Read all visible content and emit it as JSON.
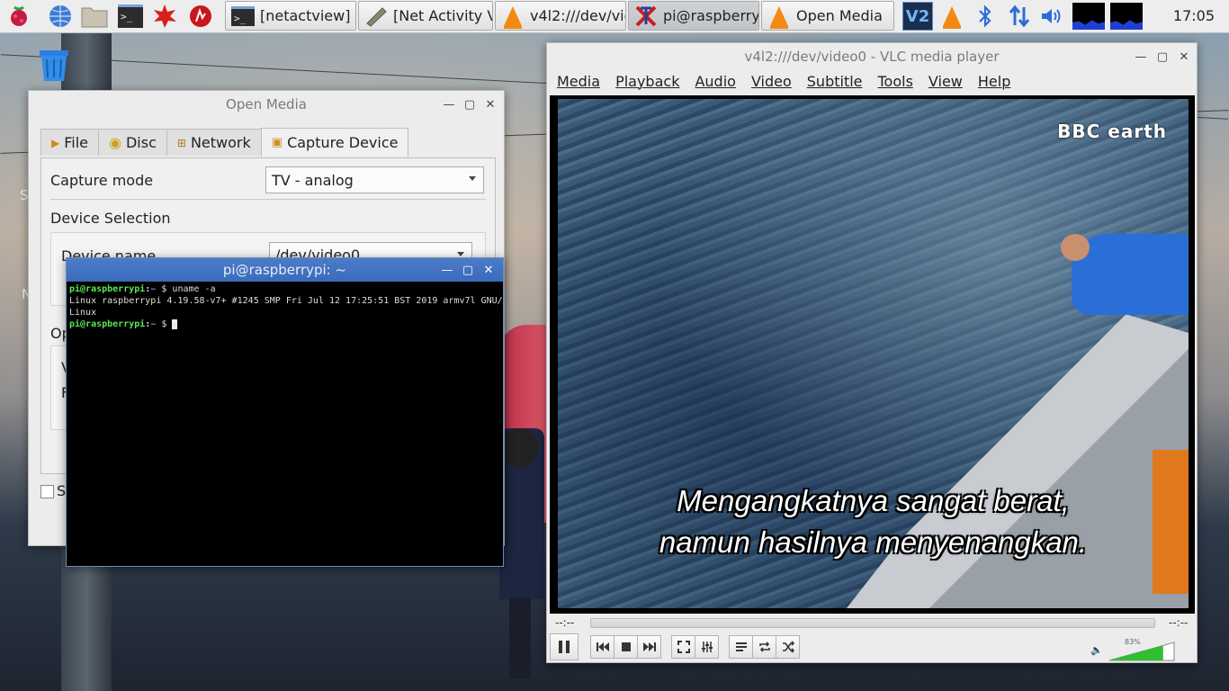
{
  "taskbar": {
    "buttons": [
      {
        "label": "[netactview]"
      },
      {
        "label": "[Net Activity V..."
      },
      {
        "label": "v4l2:///dev/vid..."
      },
      {
        "label": "pi@raspberry..."
      },
      {
        "label": "Open Media"
      }
    ],
    "clock": "17:05"
  },
  "open_media": {
    "title": "Open Media",
    "tabs": [
      "File",
      "Disc",
      "Network",
      "Capture Device"
    ],
    "capture_mode_label": "Capture mode",
    "capture_mode_value": "TV - analog",
    "device_selection_label": "Device Selection",
    "device_name_label": "Device name",
    "device_name_value": "/dev/video0",
    "partial_label_options": "Op",
    "partial_label_v": "V",
    "partial_label_f": "F",
    "partial_checkbox_label": "S"
  },
  "terminal": {
    "title": "pi@raspberrypi: ~",
    "lines": [
      {
        "user": "pi@raspberrypi",
        "path": "~",
        "cmd": "uname -a"
      },
      {
        "output": "Linux raspberrypi 4.19.58-v7+ #1245 SMP Fri Jul 12 17:25:51 BST 2019 armv7l GNU/"
      },
      {
        "output": "Linux"
      },
      {
        "user": "pi@raspberrypi",
        "path": "~",
        "cmd": ""
      }
    ]
  },
  "vlc": {
    "title": "v4l2:///dev/video0 - VLC media player",
    "menu": [
      "Media",
      "Playback",
      "Audio",
      "Video",
      "Subtitle",
      "Tools",
      "View",
      "Help"
    ],
    "video": {
      "watermark": "BBC earth",
      "subtitle_line1": "Mengangkatnya sangat berat,",
      "subtitle_line2": "namun hasilnya menyenangkan."
    },
    "time_elapsed": "--:--",
    "time_total": "--:--",
    "volume_percent": "83%",
    "volume_level": 0.83
  },
  "desktop": {
    "partial_label_1": "S",
    "partial_label_2": "N"
  }
}
